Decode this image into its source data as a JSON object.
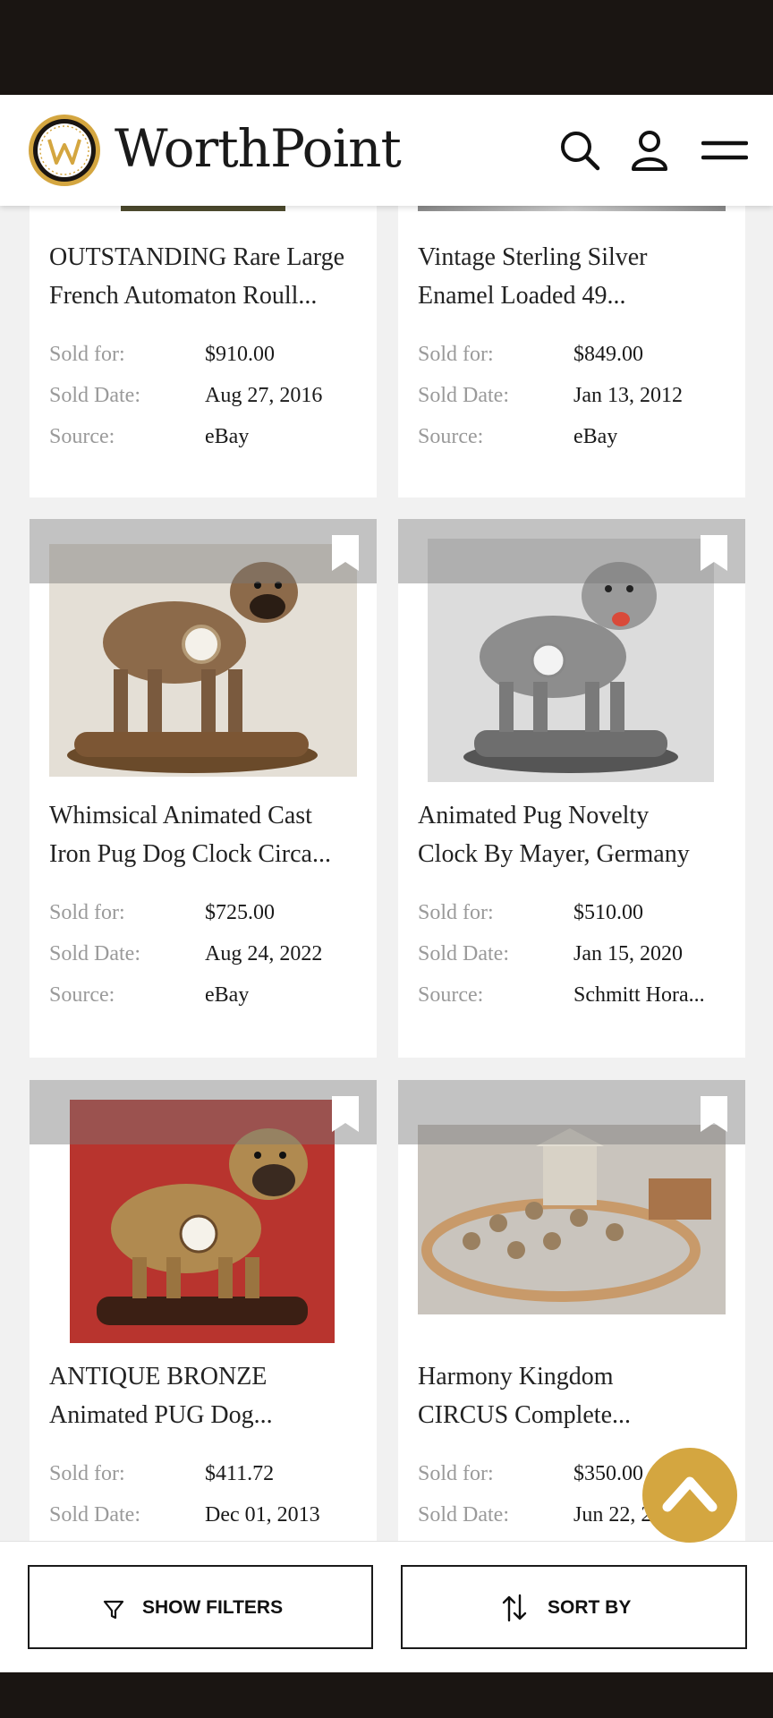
{
  "brand": {
    "name": "WorthPoint",
    "accent": "#d4a640"
  },
  "header": {
    "icons": [
      "search-icon",
      "user-icon",
      "menu-icon"
    ]
  },
  "labels": {
    "sold_for": "Sold for:",
    "sold_date": "Sold Date:",
    "source": "Source:"
  },
  "items": [
    {
      "title_line1": "OUTSTANDING Rare Large",
      "title_line2": "French Automaton Roull...",
      "sold_for": "$910.00",
      "sold_date": "Aug 27, 2016",
      "source": "eBay"
    },
    {
      "title_line1": "Vintage Sterling Silver",
      "title_line2": "Enamel Loaded 49...",
      "sold_for": "$849.00",
      "sold_date": "Jan 13, 2012",
      "source": "eBay"
    },
    {
      "title_line1": "Whimsical Animated Cast",
      "title_line2": "Iron Pug Dog Clock Circa...",
      "sold_for": "$725.00",
      "sold_date": "Aug 24, 2022",
      "source": "eBay"
    },
    {
      "title_line1": "Animated Pug Novelty",
      "title_line2": "Clock By Mayer, Germany",
      "sold_for": "$510.00",
      "sold_date": "Jan 15, 2020",
      "source": "Schmitt Hora..."
    },
    {
      "title_line1": "ANTIQUE BRONZE",
      "title_line2": "Animated PUG Dog...",
      "sold_for": "$411.72",
      "sold_date": "Dec 01, 2013",
      "source": ""
    },
    {
      "title_line1": "Harmony Kingdom",
      "title_line2": "CIRCUS Complete...",
      "sold_for": "$350.00",
      "sold_date": "Jun 22, 20...",
      "source": ""
    }
  ],
  "actions": {
    "filters_label": "SHOW FILTERS",
    "sort_label": "SORT BY"
  }
}
